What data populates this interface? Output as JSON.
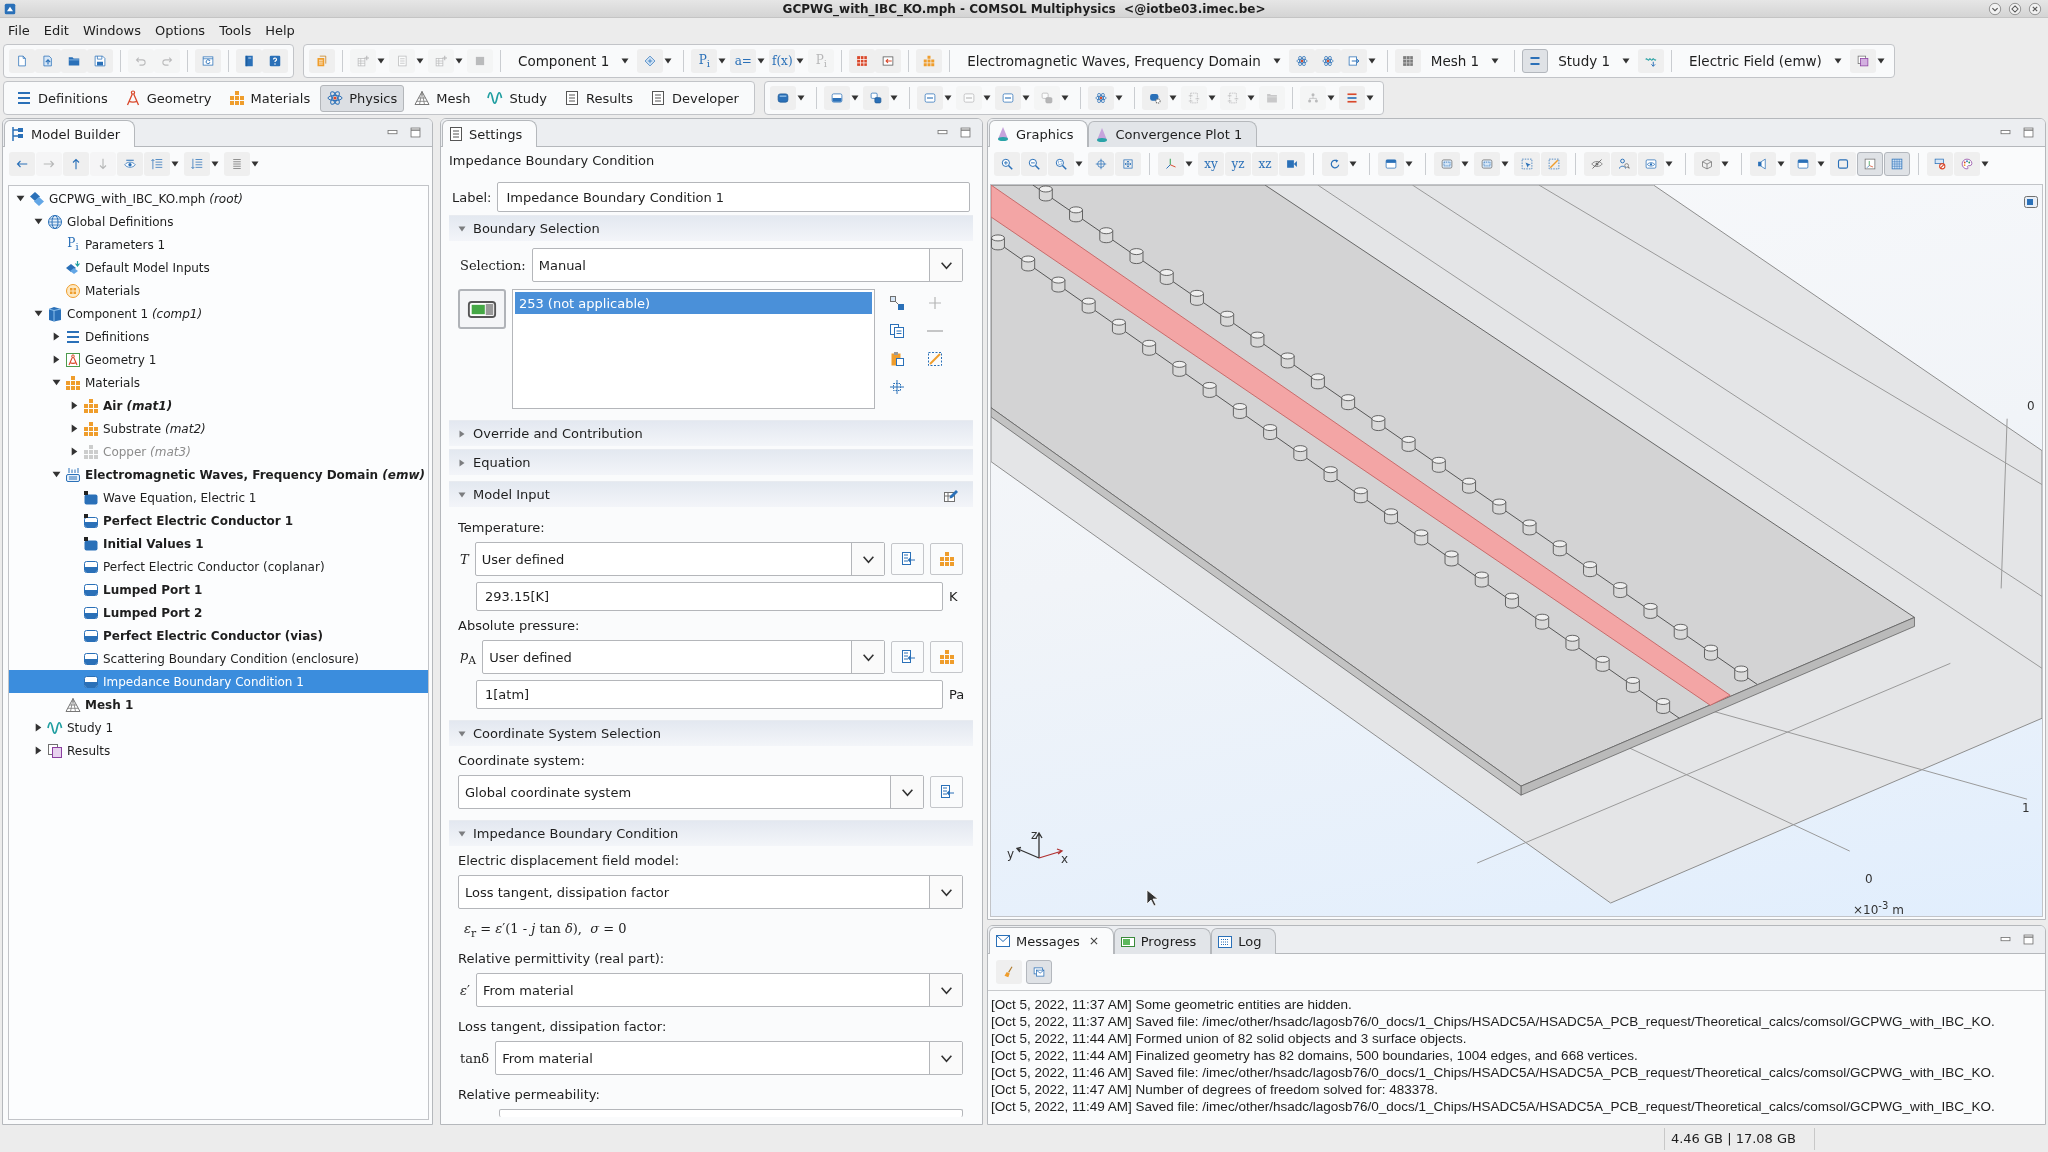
{
  "window": {
    "title": "GCPWG_with_IBC_KO.mph - COMSOL Multiphysics  <@iotbe03.imec.be>"
  },
  "menu_bar": [
    "File",
    "Edit",
    "Windows",
    "Options",
    "Tools",
    "Help"
  ],
  "main_toolbar": {
    "groups": [
      [
        {
          "kind": "button",
          "disabled": false,
          "menu": false,
          "on": false
        },
        {
          "kind": "button",
          "disabled": false,
          "menu": false,
          "on": false
        },
        {
          "kind": "button",
          "disabled": false,
          "menu": false,
          "on": false
        },
        {
          "kind": "button",
          "disabled": false,
          "menu": false,
          "on": false
        },
        {
          "kind": "separator"
        },
        {
          "kind": "button",
          "disabled": true,
          "menu": false,
          "on": false
        },
        {
          "kind": "button",
          "disabled": true,
          "menu": false,
          "on": false
        },
        {
          "kind": "separator"
        },
        {
          "kind": "button",
          "disabled": false,
          "menu": false,
          "on": false
        },
        {
          "kind": "separator"
        },
        {
          "kind": "button",
          "disabled": false,
          "menu": false,
          "on": false
        },
        {
          "kind": "button",
          "disabled": false,
          "menu": false,
          "on": false
        }
      ],
      [
        {
          "kind": "button",
          "disabled": false,
          "menu": false,
          "on": false
        },
        {
          "kind": "separator"
        },
        {
          "kind": "button",
          "disabled": true,
          "menu": true,
          "on": false
        },
        {
          "kind": "button",
          "disabled": true,
          "menu": true,
          "on": false
        },
        {
          "kind": "button",
          "disabled": true,
          "menu": true,
          "on": false
        },
        {
          "kind": "button",
          "disabled": true,
          "menu": false,
          "on": false
        },
        {
          "kind": "separator"
        },
        {
          "kind": "combo",
          "value": "Component 1"
        },
        {
          "kind": "button",
          "disabled": false,
          "menu": true,
          "on": false
        },
        {
          "kind": "separator"
        },
        {
          "kind": "text-button",
          "label": "P$_{i}$",
          "disabled": false,
          "menu": true,
          "on": false
        },
        {
          "kind": "text-button",
          "label": "a=",
          "disabled": false,
          "menu": true,
          "on": false
        },
        {
          "kind": "text-button",
          "label": "f(x)",
          "disabled": false,
          "menu": true,
          "on": false
        },
        {
          "kind": "text-button",
          "label": "P$_{i}$",
          "disabled": true,
          "menu": false,
          "on": false
        },
        {
          "kind": "separator"
        },
        {
          "kind": "button",
          "disabled": false,
          "menu": false,
          "on": false
        },
        {
          "kind": "button",
          "disabled": false,
          "menu": false,
          "on": false
        },
        {
          "kind": "separator"
        },
        {
          "kind": "button",
          "disabled": false,
          "menu": false,
          "on": false
        },
        {
          "kind": "separator"
        },
        {
          "kind": "combo",
          "value": "Electromagnetic Waves, Frequency Domain"
        },
        {
          "kind": "button",
          "disabled": false,
          "menu": false,
          "on": false
        },
        {
          "kind": "button",
          "disabled": false,
          "menu": false,
          "on": false
        },
        {
          "kind": "button",
          "disabled": false,
          "menu": true,
          "on": false
        },
        {
          "kind": "separator"
        },
        {
          "kind": "button",
          "disabled": false,
          "menu": false,
          "on": false
        },
        {
          "kind": "combo",
          "value": "Mesh 1"
        },
        {
          "kind": "separator"
        },
        {
          "kind": "button",
          "disabled": false,
          "menu": false,
          "on": true
        },
        {
          "kind": "combo",
          "value": "Study 1"
        },
        {
          "kind": "button",
          "disabled": false,
          "menu": false,
          "on": false
        },
        {
          "kind": "separator"
        },
        {
          "kind": "combo",
          "value": "Electric Field (emw)"
        },
        {
          "kind": "button",
          "disabled": false,
          "menu": true,
          "on": false
        }
      ]
    ]
  },
  "ribbon": {
    "tabs": [
      {
        "label": "Definitions",
        "selected": false
      },
      {
        "label": "Geometry",
        "selected": false
      },
      {
        "label": "Materials",
        "selected": false
      },
      {
        "label": "Physics",
        "selected": true
      },
      {
        "label": "Mesh",
        "selected": false
      },
      {
        "label": "Study",
        "selected": false
      },
      {
        "label": "Results",
        "selected": false
      },
      {
        "label": "Developer",
        "selected": false
      }
    ],
    "tools": [
      {
        "kind": "button",
        "disabled": false,
        "menu": true,
        "on": false
      },
      {
        "kind": "separator"
      },
      {
        "kind": "button",
        "disabled": false,
        "menu": true,
        "on": false
      },
      {
        "kind": "button",
        "disabled": false,
        "menu": true,
        "on": false
      },
      {
        "kind": "separator"
      },
      {
        "kind": "button",
        "disabled": false,
        "menu": true,
        "on": false
      },
      {
        "kind": "button",
        "disabled": true,
        "menu": true,
        "on": false
      },
      {
        "kind": "button",
        "disabled": false,
        "menu": true,
        "on": false
      },
      {
        "kind": "button",
        "disabled": true,
        "menu": true,
        "on": false
      },
      {
        "kind": "separator"
      },
      {
        "kind": "button",
        "disabled": false,
        "menu": true,
        "on": false
      },
      {
        "kind": "separator"
      },
      {
        "kind": "button",
        "disabled": false,
        "menu": true,
        "on": false
      },
      {
        "kind": "button",
        "disabled": true,
        "menu": true,
        "on": false
      },
      {
        "kind": "button",
        "disabled": true,
        "menu": true,
        "on": false
      },
      {
        "kind": "button",
        "disabled": true,
        "menu": false,
        "on": false
      },
      {
        "kind": "separator"
      },
      {
        "kind": "button",
        "disabled": true,
        "menu": true,
        "on": false
      },
      {
        "kind": "button",
        "disabled": false,
        "menu": true,
        "on": false
      }
    ]
  },
  "model_builder": {
    "title": "Model Builder",
    "toolbar": [
      {
        "kind": "button",
        "disabled": false,
        "menu": false,
        "on": false
      },
      {
        "kind": "button",
        "disabled": true,
        "menu": false,
        "on": false
      },
      {
        "kind": "button",
        "disabled": false,
        "menu": false,
        "on": false
      },
      {
        "kind": "button",
        "disabled": true,
        "menu": false,
        "on": false
      },
      {
        "kind": "button",
        "disabled": false,
        "menu": false,
        "on": false
      },
      {
        "kind": "button",
        "disabled": false,
        "menu": true,
        "on": false
      },
      {
        "kind": "button",
        "disabled": false,
        "menu": true,
        "on": false
      },
      {
        "kind": "button",
        "disabled": false,
        "menu": true,
        "on": false
      }
    ],
    "tree": [
      {
        "label": "GCPWG_with_IBC_KO.mph *(root)*",
        "kind": "model",
        "expanded": true,
        "bold": false,
        "disabled": false,
        "selected": false,
        "children": [
          {
            "label": "Global Definitions",
            "kind": "globe",
            "expanded": true,
            "bold": false,
            "disabled": false,
            "selected": false,
            "children": [
              {
                "label": "Parameters 1",
                "kind": "parameters",
                "symbol": "P$_{i}$",
                "bold": false,
                "disabled": false,
                "selected": false
              },
              {
                "label": "Default Model Inputs",
                "kind": "model-inputs",
                "bold": false,
                "disabled": false,
                "selected": false
              },
              {
                "label": "Materials",
                "kind": "global-materials",
                "bold": false,
                "disabled": false,
                "selected": false
              }
            ]
          },
          {
            "label": "Component 1 *(comp1)*",
            "kind": "component",
            "expanded": true,
            "bold": false,
            "disabled": false,
            "selected": false,
            "children": [
              {
                "label": "Definitions",
                "kind": "definitions",
                "expanded": false,
                "bold": false,
                "disabled": false,
                "selected": false
              },
              {
                "label": "Geometry 1",
                "kind": "geometry",
                "expanded": false,
                "bold": false,
                "disabled": false,
                "selected": false
              },
              {
                "label": "Materials",
                "kind": "materials",
                "expanded": true,
                "bold": false,
                "disabled": false,
                "selected": false,
                "children": [
                  {
                    "label": "Air *(mat1)*",
                    "kind": "material",
                    "expanded": false,
                    "bold": true,
                    "disabled": false,
                    "selected": false
                  },
                  {
                    "label": "Substrate *(mat2)*",
                    "kind": "material",
                    "expanded": false,
                    "bold": false,
                    "disabled": false,
                    "selected": false
                  },
                  {
                    "label": "Copper *(mat3)*",
                    "kind": "material",
                    "expanded": false,
                    "bold": false,
                    "disabled": true,
                    "selected": false
                  }
                ]
              },
              {
                "label": "Electromagnetic Waves, Frequency Domain *(emw)*",
                "kind": "physics",
                "expanded": true,
                "bold": true,
                "disabled": false,
                "selected": false,
                "children": [
                  {
                    "label": "Wave Equation, Electric 1",
                    "kind": "domain-default",
                    "bold": false,
                    "disabled": false,
                    "selected": false
                  },
                  {
                    "label": "Perfect Electric Conductor 1",
                    "kind": "boundary-default",
                    "bold": true,
                    "disabled": false,
                    "selected": false
                  },
                  {
                    "label": "Initial Values 1",
                    "kind": "domain-default",
                    "bold": true,
                    "disabled": false,
                    "selected": false
                  },
                  {
                    "label": "Perfect Electric Conductor (coplanar)",
                    "kind": "boundary",
                    "bold": false,
                    "disabled": false,
                    "selected": false
                  },
                  {
                    "label": "Lumped Port 1",
                    "kind": "boundary",
                    "bold": true,
                    "disabled": false,
                    "selected": false
                  },
                  {
                    "label": "Lumped Port 2",
                    "kind": "boundary",
                    "bold": true,
                    "disabled": false,
                    "selected": false
                  },
                  {
                    "label": "Perfect Electric Conductor (vias)",
                    "kind": "boundary",
                    "bold": true,
                    "disabled": false,
                    "selected": false
                  },
                  {
                    "label": "Scattering Boundary Condition (enclosure)",
                    "kind": "boundary",
                    "bold": false,
                    "disabled": false,
                    "selected": false
                  },
                  {
                    "label": "Impedance Boundary Condition 1",
                    "kind": "boundary",
                    "bold": false,
                    "disabled": false,
                    "selected": true
                  }
                ]
              },
              {
                "label": "Mesh 1",
                "kind": "mesh",
                "bold": true,
                "disabled": false,
                "selected": false
              }
            ]
          },
          {
            "label": "Study 1",
            "kind": "study",
            "expanded": false,
            "bold": false,
            "disabled": false,
            "selected": false
          },
          {
            "label": "Results",
            "kind": "results",
            "expanded": false,
            "bold": false,
            "disabled": false,
            "selected": false
          }
        ]
      }
    ]
  },
  "settings": {
    "title": "Settings",
    "heading": "Impedance Boundary Condition",
    "label": {
      "caption": "Label:",
      "value": "Impedance Boundary Condition 1"
    },
    "sections": [
      {
        "title": "Boundary Selection",
        "expanded": true,
        "edit_button": false,
        "rows": [
          {
            "kind": "combo",
            "label": "Selection:",
            "value": "Manual"
          },
          {
            "kind": "selection",
            "active": true,
            "items": [
              {
                "text": "253 (not applicable)",
                "selected": true
              }
            ],
            "tools": [
              {
                "disabled": false
              },
              {
                "disabled": true
              },
              {
                "disabled": false
              },
              {
                "disabled": true
              },
              {
                "disabled": false
              },
              {
                "disabled": false
              },
              {
                "disabled": false
              }
            ]
          }
        ]
      },
      {
        "title": "Override and Contribution",
        "expanded": false,
        "edit_button": false
      },
      {
        "title": "Equation",
        "expanded": false,
        "edit_button": false
      },
      {
        "title": "Model Input",
        "expanded": true,
        "edit_button": true,
        "rows": [
          {
            "kind": "caption",
            "text": "Temperature:"
          },
          {
            "kind": "combo",
            "label": "*T*",
            "value": "User defined",
            "buttons": [
              {
                "disabled": false
              },
              {
                "disabled": false
              }
            ]
          },
          {
            "kind": "field",
            "value": "293.15[K]",
            "unit": "K"
          },
          {
            "kind": "caption",
            "text": "Absolute pressure:"
          },
          {
            "kind": "combo",
            "label": "*p*$_{A}$",
            "value": "User defined",
            "buttons": [
              {
                "disabled": false
              },
              {
                "disabled": false
              }
            ]
          },
          {
            "kind": "field",
            "value": "1[atm]",
            "unit": "Pa"
          }
        ]
      },
      {
        "title": "Coordinate System Selection",
        "expanded": true,
        "edit_button": false,
        "rows": [
          {
            "kind": "caption",
            "text": "Coordinate system:"
          },
          {
            "kind": "combo",
            "value": "Global coordinate system",
            "buttons": [
              {
                "disabled": false
              }
            ]
          }
        ]
      },
      {
        "title": "Impedance Boundary Condition",
        "expanded": true,
        "edit_button": false,
        "rows": [
          {
            "kind": "caption",
            "text": "Electric displacement field model:"
          },
          {
            "kind": "combo",
            "value": "Loss tangent, dissipation factor"
          },
          {
            "kind": "formula",
            "text": "*ε*$_{r}$ = *ε*′(1 - *j* tan *δ*),  *σ* = 0"
          },
          {
            "kind": "caption",
            "text": "Relative permittivity (real part):"
          },
          {
            "kind": "combo",
            "label": "*ε*′",
            "value": "From material"
          },
          {
            "kind": "caption",
            "text": "Loss tangent, dissipation factor:"
          },
          {
            "kind": "combo",
            "label": "tanδ",
            "value": "From material"
          },
          {
            "kind": "caption",
            "text": "Relative permeability:"
          },
          {
            "kind": "combo"
          }
        ]
      }
    ]
  },
  "graphics": {
    "tabs": [
      {
        "label": "Graphics",
        "selected": true
      },
      {
        "label": "Convergence Plot 1",
        "selected": false
      }
    ],
    "toolbar": [
      {
        "kind": "button",
        "disabled": false,
        "menu": false,
        "on": false
      },
      {
        "kind": "button",
        "disabled": false,
        "menu": false,
        "on": false
      },
      {
        "kind": "button",
        "disabled": false,
        "menu": true,
        "on": false
      },
      {
        "kind": "button",
        "disabled": false,
        "menu": false,
        "on": false
      },
      {
        "kind": "button",
        "disabled": false,
        "menu": false,
        "on": false
      },
      {
        "kind": "separator"
      },
      {
        "kind": "button",
        "disabled": false,
        "menu": true,
        "on": false
      },
      {
        "kind": "text-button",
        "label": "xy",
        "disabled": false,
        "menu": false,
        "on": false
      },
      {
        "kind": "text-button",
        "label": "yz",
        "disabled": false,
        "menu": false,
        "on": false
      },
      {
        "kind": "text-button",
        "label": "xz",
        "disabled": false,
        "menu": false,
        "on": false
      },
      {
        "kind": "button",
        "disabled": false,
        "menu": false,
        "on": false
      },
      {
        "kind": "separator"
      },
      {
        "kind": "button",
        "disabled": false,
        "menu": true,
        "on": false
      },
      {
        "kind": "separator"
      },
      {
        "kind": "button",
        "disabled": false,
        "menu": true,
        "on": false
      },
      {
        "kind": "separator"
      },
      {
        "kind": "button",
        "disabled": false,
        "menu": true,
        "on": false
      },
      {
        "kind": "button",
        "disabled": false,
        "menu": true,
        "on": false
      },
      {
        "kind": "button",
        "disabled": false,
        "menu": false,
        "on": false
      },
      {
        "kind": "button",
        "disabled": false,
        "menu": false,
        "on": false
      },
      {
        "kind": "separator"
      },
      {
        "kind": "button",
        "disabled": false,
        "menu": false,
        "on": false
      },
      {
        "kind": "button",
        "disabled": false,
        "menu": false,
        "on": false
      },
      {
        "kind": "button",
        "disabled": false,
        "menu": true,
        "on": false
      },
      {
        "kind": "separator"
      },
      {
        "kind": "button",
        "disabled": false,
        "menu": true,
        "on": false
      },
      {
        "kind": "separator"
      },
      {
        "kind": "button",
        "disabled": false,
        "menu": true,
        "on": false
      },
      {
        "kind": "button",
        "disabled": false,
        "menu": true,
        "on": false
      },
      {
        "kind": "button",
        "disabled": false,
        "menu": false,
        "on": false
      },
      {
        "kind": "button",
        "disabled": false,
        "menu": false,
        "on": true
      },
      {
        "kind": "button",
        "disabled": false,
        "menu": false,
        "on": true
      },
      {
        "kind": "separator"
      },
      {
        "kind": "button",
        "disabled": false,
        "menu": false,
        "on": false
      },
      {
        "kind": "button",
        "disabled": false,
        "menu": true,
        "on": false
      }
    ],
    "tick_labels": [
      "0",
      "1",
      "0"
    ],
    "unit_label": "×10$^{-3}$ m",
    "triad_labels": [
      "z",
      "y",
      "x"
    ]
  },
  "messages": {
    "tabs": [
      {
        "label": "Messages",
        "selected": true,
        "closable": true
      },
      {
        "label": "Progress",
        "selected": false,
        "closable": false
      },
      {
        "label": "Log",
        "selected": false,
        "closable": false
      }
    ],
    "toolbar": [
      {
        "kind": "button",
        "disabled": false,
        "menu": false,
        "on": false
      },
      {
        "kind": "button",
        "disabled": false,
        "menu": false,
        "on": true
      }
    ],
    "lines": [
      "[Oct 5, 2022, 11:37 AM] Some geometric entities are hidden.",
      "[Oct 5, 2022, 11:37 AM] Saved file: /imec/other/hsadc/lagosb76/0_docs/1_Chips/HSADC5A/HSADC5A_PCB_request/Theoretical_calcs/comsol/GCPWG_with_IBC_KO.",
      "[Oct 5, 2022, 11:44 AM] Formed union of 82 solid objects and 3 surface objects.",
      "[Oct 5, 2022, 11:44 AM] Finalized geometry has 82 domains, 500 boundaries, 1004 edges, and 668 vertices.",
      "[Oct 5, 2022, 11:46 AM] Saved file: /imec/other/hsadc/lagosb76/0_docs/1_Chips/HSADC5A/HSADC5A_PCB_request/Theoretical_calcs/comsol/GCPWG_with_IBC_KO.",
      "[Oct 5, 2022, 11:47 AM] Number of degrees of freedom solved for: 483378.",
      "[Oct 5, 2022, 11:49 AM] Saved file: /imec/other/hsadc/lagosb76/0_docs/1_Chips/HSADC5A/HSADC5A_PCB_request/Theoretical_calcs/comsol/GCPWG_with_IBC_KO."
    ]
  },
  "status_bar": {
    "memory": "4.46 GB | 17.08 GB"
  }
}
